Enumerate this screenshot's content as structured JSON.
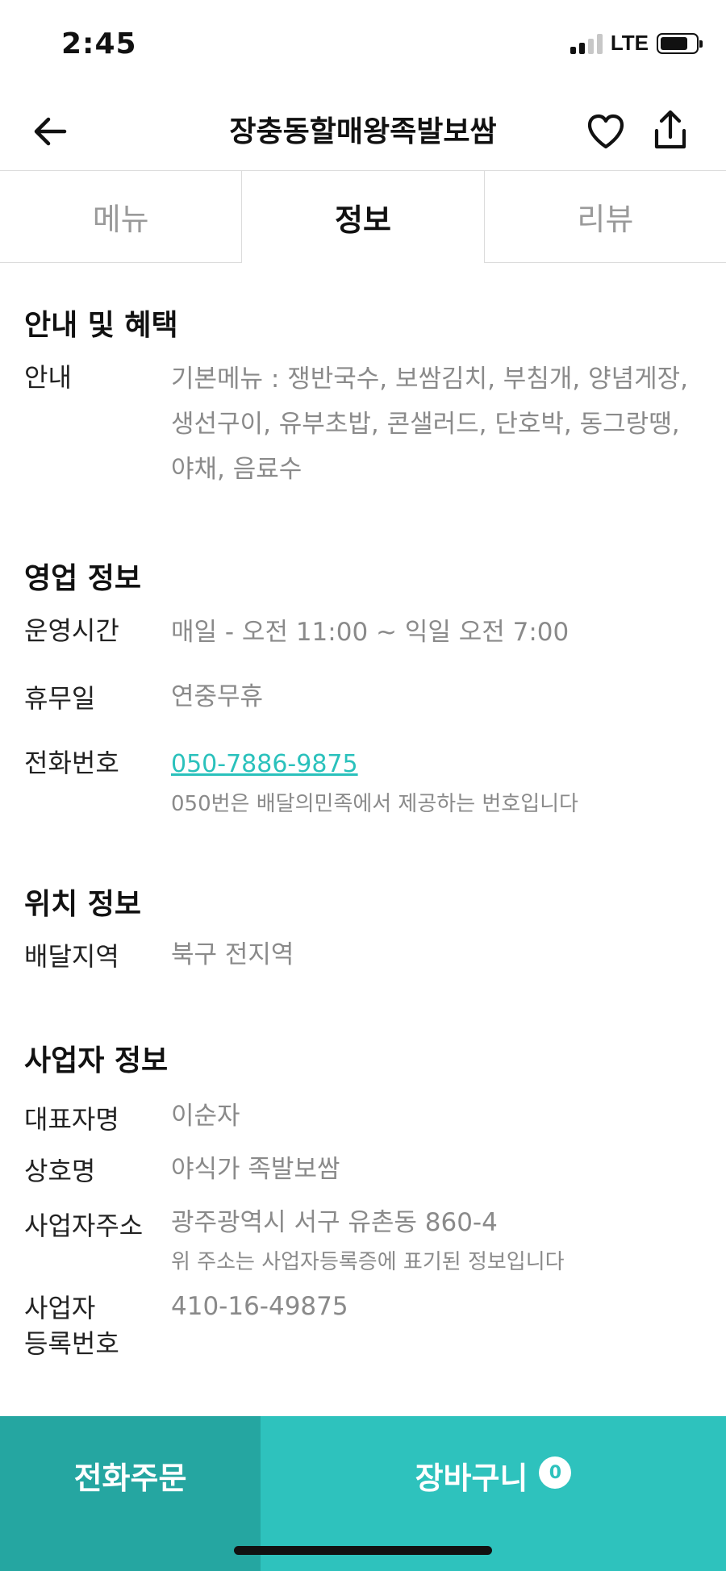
{
  "status_bar": {
    "time": "2:45",
    "network": "LTE"
  },
  "header": {
    "title": "장충동할매왕족발보쌈",
    "icons": [
      "back-arrow-icon",
      "heart-icon",
      "share-icon"
    ]
  },
  "tabs": [
    {
      "label": "메뉴",
      "active": false
    },
    {
      "label": "정보",
      "active": true
    },
    {
      "label": "리뷰",
      "active": false
    }
  ],
  "sections": {
    "notice": {
      "title": "안내 및 혜택",
      "rows": [
        {
          "label": "안내",
          "value_lines": [
            "기본메뉴 : 쟁반국수, 보쌈김치, 부침개, 양념게장,",
            "생선구이, 유부초밥, 콘샐러드, 단호박, 동그랑땡,",
            "야채, 음료수"
          ]
        }
      ]
    },
    "business_hours": {
      "title": "영업 정보",
      "hours_label": "운영시간",
      "hours_value": "매일 - 오전 11:00 ~ 익일 오전 7:00",
      "holiday_label": "휴무일",
      "holiday_value": "연중무휴",
      "phone_label": "전화번호",
      "phone_value": "050-7886-9875",
      "phone_note": "050번은 배달의민족에서 제공하는 번호입니다"
    },
    "location": {
      "title": "위치 정보",
      "area_label": "배달지역",
      "area_value": "북구 전지역"
    },
    "business_info": {
      "title": "사업자 정보",
      "owner_label": "대표자명",
      "owner_value": "이순자",
      "company_label": "상호명",
      "company_value": "야식가 족발보쌈",
      "address_label": "사업자주소",
      "address_value": "광주광역시 서구 유촌동 860-4",
      "address_note": "위 주소는 사업자등록증에 표기된 정보입니다",
      "regno_label_line1": "사업자",
      "regno_label_line2": "등록번호",
      "regno_value": "410-16-49875"
    }
  },
  "bottom_bar": {
    "call_label": "전화주문",
    "cart_label": "장바구니",
    "cart_count": "0"
  },
  "colors": {
    "accent": "#2ac1bc",
    "call_button": "#25a6a1",
    "cart_button": "#2ec2bd"
  }
}
